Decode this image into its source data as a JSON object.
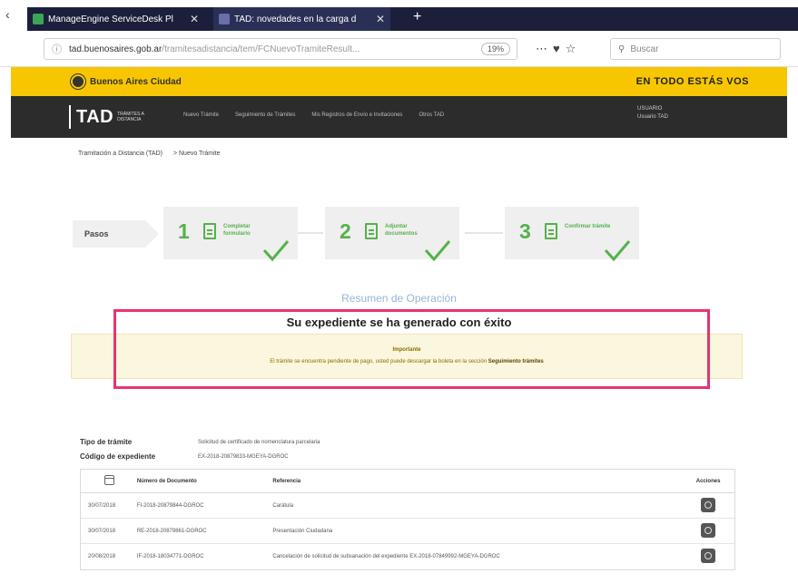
{
  "browser": {
    "tabs": [
      {
        "title": "ManageEngine ServiceDesk Pl",
        "favicon_color": "#3aa655",
        "active": false
      },
      {
        "title": "TAD: novedades en la carga d",
        "favicon_color": "#6a6fa8",
        "active": true
      }
    ],
    "new_tab_symbol": "+",
    "url_domain": "tad.buenosaires.gob.ar",
    "url_path": "/tramitesadistancia/tem/FCNuevoTramiteResult...",
    "zoom": "19%",
    "search_placeholder": "Buscar"
  },
  "site": {
    "brand": "Buenos Aires Ciudad",
    "slogan": "EN TODO ESTÁS VOS",
    "tad_logo": "TAD",
    "tad_sub": "TRÁMITES A DISTANCIA",
    "nav": [
      "Nuevo Trámite",
      "Seguimiento de Trámites",
      "Mis Registros de Envío e Invitaciones",
      "Otros TAD"
    ],
    "user_line1": "USUARIO",
    "user_line2": "Usuario TAD"
  },
  "breadcrumb": [
    "Tramitación a Distancia (TAD)",
    "> Nuevo Trámite"
  ],
  "steps": {
    "pasos_label": "Pasos",
    "items": [
      {
        "number": "1",
        "label": "Completar formulario"
      },
      {
        "number": "2",
        "label": "Adjuntar documentos"
      },
      {
        "number": "3",
        "label": "Confirmar trámite"
      }
    ]
  },
  "summary": {
    "section_title": "Resumen de Operación",
    "success_message": "Su expediente se ha generado con éxito",
    "notice_title": "Importante",
    "notice_text": "El trámite se encuentra pendiente de pago, usted puede descargar la boleta en la sección",
    "notice_link": "Seguimiento trámites"
  },
  "details": {
    "tipo_label": "Tipo de trámite",
    "tipo_value": "Solicitud de certificado de nomenclatura parcelaria",
    "codigo_label": "Código de expediente",
    "codigo_value": "EX-2018-20879833-MGEYA-DGROC"
  },
  "table": {
    "headers": [
      "",
      "Número de Documento",
      "Referencia",
      "Acciones"
    ],
    "rows": [
      {
        "date": "30/07/2018",
        "doc": "FI-2018-20879844-DGROC",
        "ref": "Carátula"
      },
      {
        "date": "30/07/2018",
        "doc": "RE-2018-20879861-DGROC",
        "ref": "Presentación Ciudadana"
      },
      {
        "date": "20/08/2018",
        "doc": "IF-2018-18034771-DGROC",
        "ref": "Cancelación de solicitud de subsanación del expediente EX-2018-07849992-MGEYA-DGROC"
      }
    ]
  },
  "colors": {
    "yellow": "#f7c600",
    "dark": "#2c2c2c",
    "green": "#54b24b",
    "highlight": "#e8336d"
  }
}
